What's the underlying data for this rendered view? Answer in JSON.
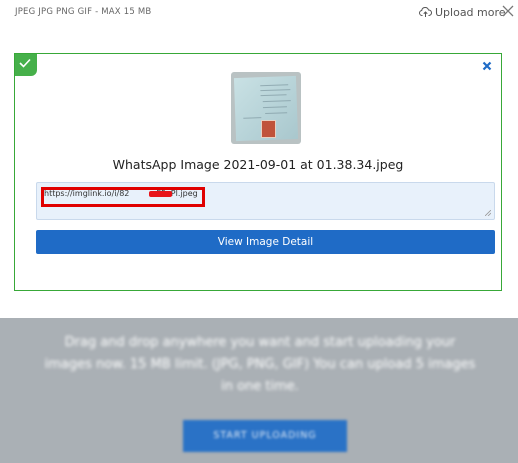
{
  "header": {
    "formats_text": "JPEG JPG PNG GIF - MAX 15 MB",
    "upload_more_label": "Upload more",
    "upload_icon": "cloud-upload-icon",
    "close_icon": "close-icon"
  },
  "upload_result": {
    "status_icon": "checkmark-icon",
    "close_icon": "close-icon",
    "filename": "WhatsApp Image 2021-09-01 at 01.38.34.jpeg",
    "link_value": "https://imglink.io/i/82XXXXF5vPl.jpeg",
    "link_display_prefix": "https://imglink.io/i/82",
    "link_display_suffix": "F5vPl.jpeg",
    "view_button_label": "View Image Detail"
  },
  "background_page": {
    "description_text": "Drag and drop anywhere you want and start uploading your images now. 15 MB limit. (JPG, PNG, GIF) You can upload 5 images in one time.",
    "start_button_label": "START UPLOADING"
  },
  "colors": {
    "success_green": "#46b04a",
    "primary_blue": "#1f6bc6",
    "annotation_red": "#e00000",
    "link_box_bg": "#e8f1fb"
  }
}
